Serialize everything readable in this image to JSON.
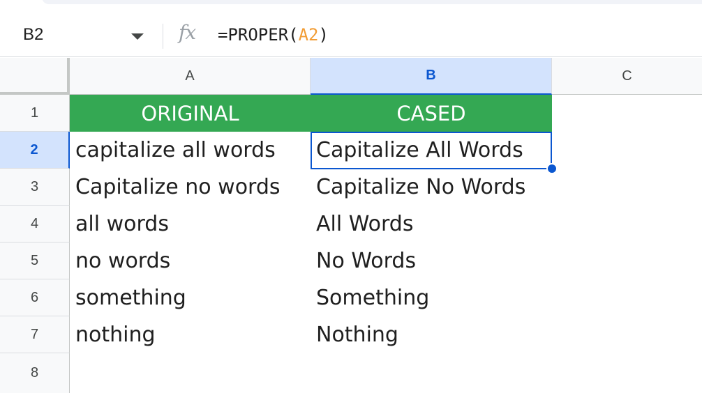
{
  "name_box": {
    "cell_ref": "B2"
  },
  "formula_bar": {
    "fx_symbol": "fx",
    "formula_prefix": "=PROPER(",
    "formula_ref": "A2",
    "formula_suffix": ")"
  },
  "columns": [
    "A",
    "B",
    "C"
  ],
  "rows": [
    "1",
    "2",
    "3",
    "4",
    "5",
    "6",
    "7",
    "8"
  ],
  "selected_cell": "B2",
  "table": {
    "header_a": "ORIGINAL",
    "header_b": "CASED",
    "header_color": "#34a853",
    "original": [
      "capitalize all words",
      "Capitalize no words",
      "all words",
      "no words",
      "something",
      "nothing"
    ],
    "cased": [
      "Capitalize All Words",
      "Capitalize No Words",
      "All Words",
      "No Words",
      "Something",
      "Nothing"
    ]
  },
  "colors": {
    "accent": "#0b57d0",
    "selection_fill": "#d3e3fd",
    "ref_highlight": "#f29d35"
  }
}
